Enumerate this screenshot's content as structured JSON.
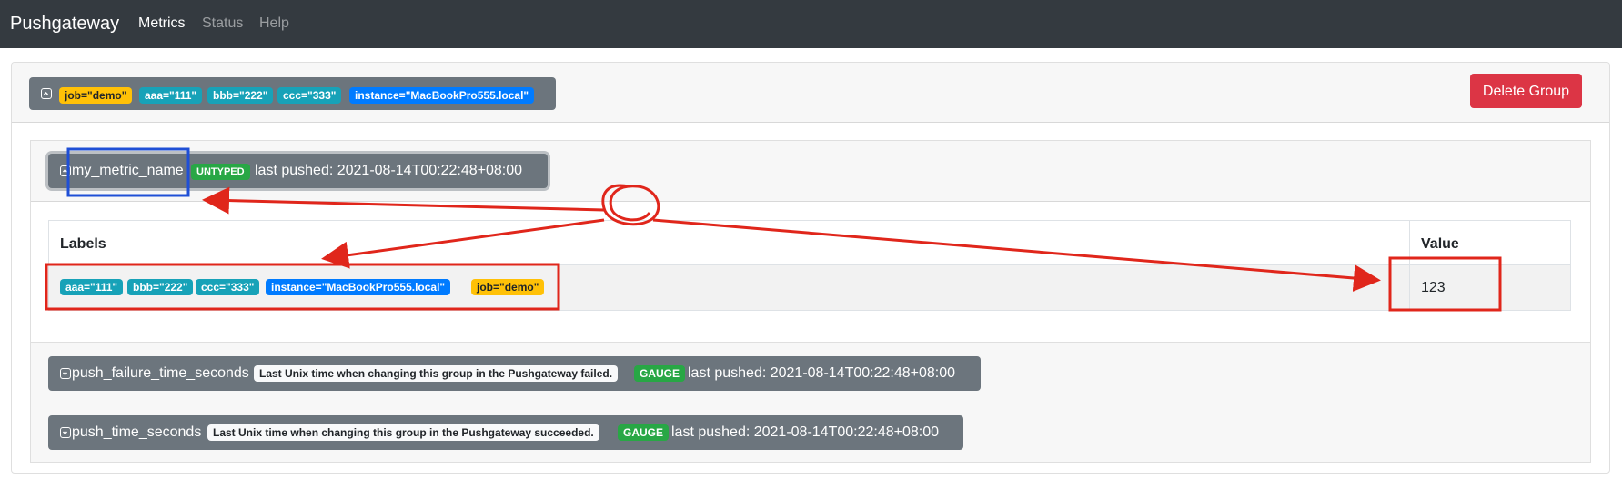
{
  "navbar": {
    "brand": "Pushgateway",
    "links": [
      {
        "label": "Metrics",
        "active": true
      },
      {
        "label": "Status",
        "active": false
      },
      {
        "label": "Help",
        "active": false
      }
    ]
  },
  "group": {
    "labels": [
      "job=\"demo\"",
      "aaa=\"111\"",
      "bbb=\"222\"",
      "ccc=\"333\"",
      "instance=\"MacBookPro555.local\""
    ],
    "delete_label": "Delete Group"
  },
  "metrics": [
    {
      "name": "my_metric_name",
      "type": "UNTYPED",
      "help": "",
      "last_pushed": "last pushed: 2021-08-14T00:22:48+08:00",
      "expanded": true,
      "table": {
        "headers": [
          "Labels",
          "Value"
        ],
        "rows": [
          {
            "labels": [
              "aaa=\"111\"",
              "bbb=\"222\"",
              "ccc=\"333\"",
              "instance=\"MacBookPro555.local\"",
              "job=\"demo\""
            ],
            "value": "123"
          }
        ]
      }
    },
    {
      "name": "push_failure_time_seconds",
      "type": "GAUGE",
      "help": "Last Unix time when changing this group in the Pushgateway failed.",
      "last_pushed": "last pushed: 2021-08-14T00:22:48+08:00",
      "expanded": false
    },
    {
      "name": "push_time_seconds",
      "type": "GAUGE",
      "help": "Last Unix time when changing this group in the Pushgateway succeeded.",
      "last_pushed": "last pushed: 2021-08-14T00:22:48+08:00",
      "expanded": false
    }
  ],
  "colors": {
    "navbar_bg": "#343a40",
    "badge_warning": "#ffc107",
    "badge_info": "#17a2b8",
    "badge_primary": "#007bff",
    "badge_success": "#28a745",
    "danger": "#dc3545",
    "annotation_red": "#e0261b",
    "annotation_blue": "#1f4fd6"
  }
}
